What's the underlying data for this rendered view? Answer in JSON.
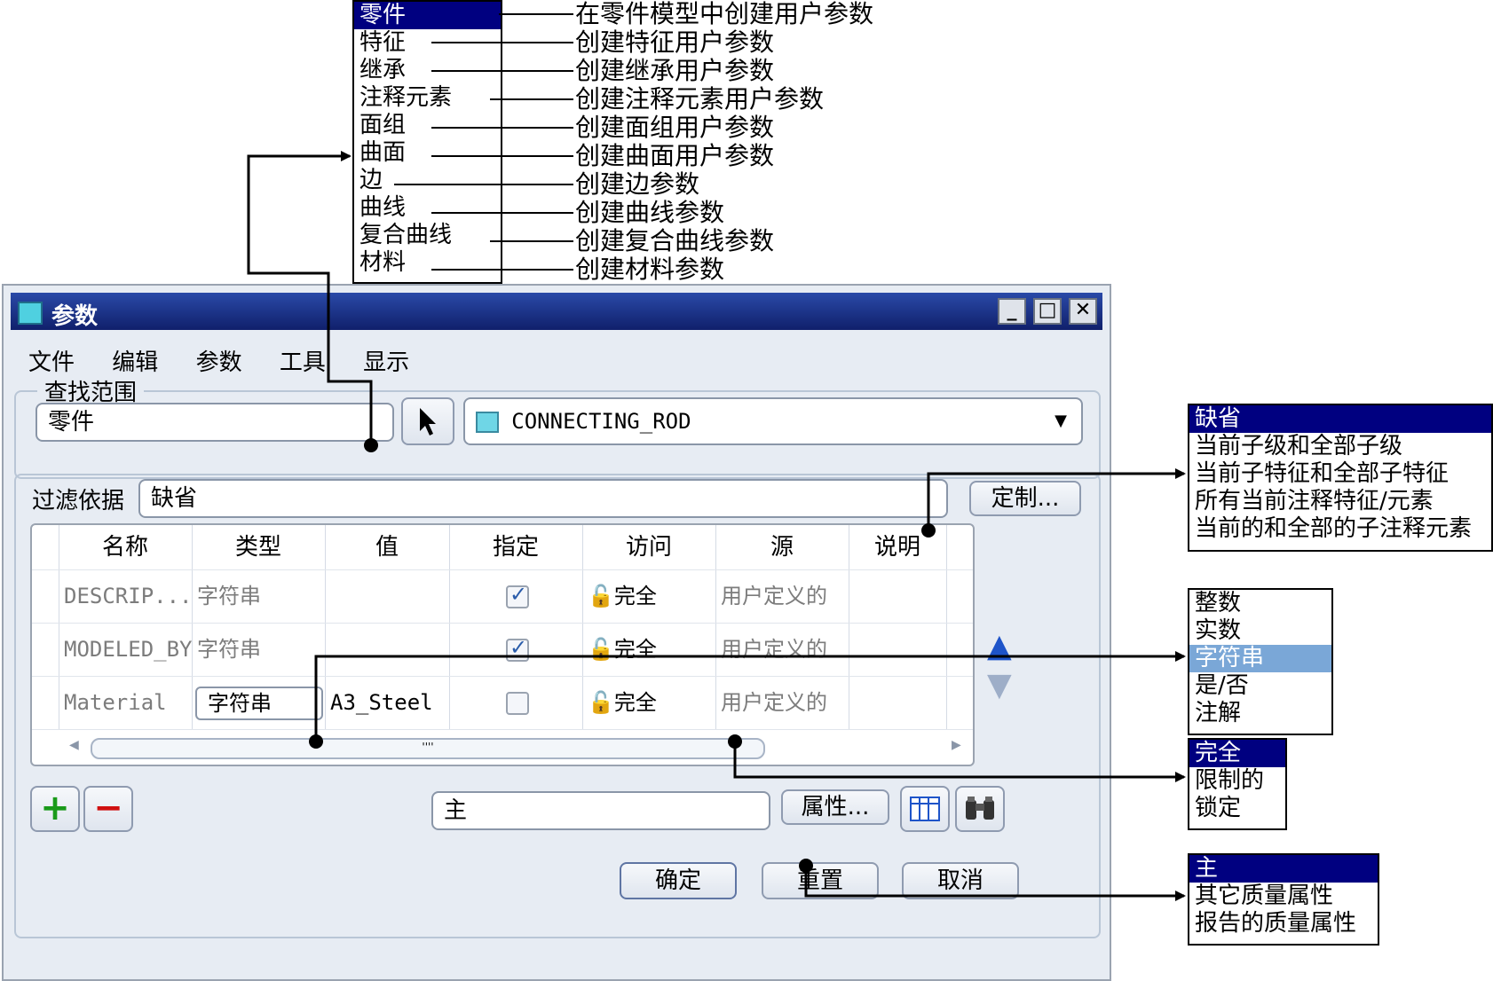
{
  "dialog": {
    "title": "参数",
    "menu": [
      "文件",
      "编辑",
      "参数",
      "工具",
      "显示"
    ],
    "lookin": {
      "group_label": "查找范围",
      "type_value": "零件",
      "model_value": "CONNECTING_ROD"
    },
    "filter": {
      "label": "过滤依据",
      "value": "缺省",
      "customize_label": "定制..."
    },
    "table": {
      "columns": [
        "名称",
        "类型",
        "值",
        "指定",
        "访问",
        "源",
        "说明"
      ],
      "rows": [
        {
          "name": "DESCRIP...",
          "type": "字符串",
          "value": "",
          "designate": true,
          "access": "完全",
          "source": "用户定义的"
        },
        {
          "name": "MODELED_BY",
          "type": "字符串",
          "value": "",
          "designate": true,
          "access": "完全",
          "source": "用户定义的"
        },
        {
          "name": "Material",
          "type": "字符串",
          "value": "A3_Steel",
          "designate": false,
          "access": "完全",
          "source": "用户定义的"
        }
      ],
      "scroll_grip": "''''"
    },
    "bottom": {
      "mass_value": "主",
      "properties_label": "属性..."
    },
    "buttons": {
      "ok": "确定",
      "reset": "重置",
      "cancel": "取消"
    }
  },
  "callouts": {
    "object_types": [
      "零件",
      "特征",
      "继承",
      "注释元素",
      "面组",
      "曲面",
      "边",
      "曲线",
      "复合曲线",
      "材料"
    ],
    "object_descs": [
      "在零件模型中创建用户参数",
      "创建特征用户参数",
      "创建继承用户参数",
      "创建注释元素用户参数",
      "创建面组用户参数",
      "创建曲面用户参数",
      "创建边参数",
      "创建曲线参数",
      "创建复合曲线参数",
      "创建材料参数"
    ],
    "filter_options": [
      "缺省",
      "当前子级和全部子级",
      "当前子特征和全部子特征",
      "所有当前注释特征/元素",
      "当前的和全部的子注释元素"
    ],
    "type_options": [
      "整数",
      "实数",
      "字符串",
      "是/否",
      "注解"
    ],
    "access_options": [
      "完全",
      "限制的",
      "锁定"
    ],
    "mass_options": [
      "主",
      "其它质量属性",
      "报告的质量属性"
    ]
  },
  "colors": {
    "title_bar": "#10206b",
    "selected": "#000080",
    "highlight": "#7aa7d7",
    "dialog_bg": "#e7ecf3"
  }
}
